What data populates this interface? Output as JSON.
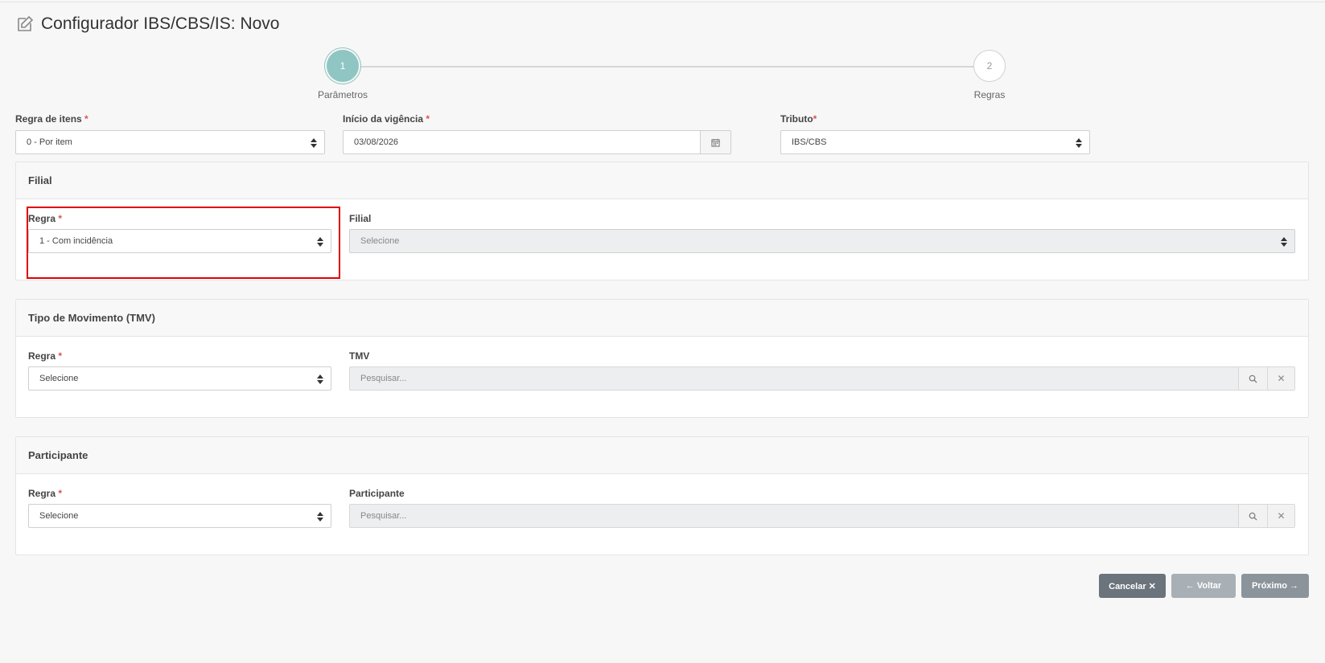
{
  "header": {
    "title": "Configurador IBS/CBS/IS: Novo",
    "icon": "edit-icon"
  },
  "stepper": {
    "steps": [
      {
        "number": "1",
        "label": "Parâmetros"
      },
      {
        "number": "2",
        "label": "Regras"
      }
    ],
    "active_step": 1
  },
  "params": {
    "regra_itens": {
      "label": "Regra de itens",
      "required": "*",
      "value": "0 - Por item"
    },
    "inicio_vigencia": {
      "label": "Início da vigência",
      "required": "*",
      "value": "03/08/2026"
    },
    "tributo": {
      "label": "Tributo",
      "required": "*",
      "value": "IBS/CBS"
    }
  },
  "filial_panel": {
    "title": "Filial",
    "regra": {
      "label": "Regra",
      "required": "*",
      "value": "1 - Com incidência"
    },
    "filial": {
      "label": "Filial",
      "placeholder": "Selecione"
    }
  },
  "tmv_panel": {
    "title": "Tipo de Movimento (TMV)",
    "regra": {
      "label": "Regra",
      "required": "*",
      "value": "Selecione"
    },
    "tmv": {
      "label": "TMV",
      "placeholder": "Pesquisar..."
    }
  },
  "participante_panel": {
    "title": "Participante",
    "regra": {
      "label": "Regra",
      "required": "*",
      "value": "Selecione"
    },
    "participante": {
      "label": "Participante",
      "placeholder": "Pesquisar..."
    }
  },
  "actions": {
    "cancel": "Cancelar ✕",
    "back": "← Voltar",
    "next": "Próximo →"
  },
  "colors": {
    "accent": "#8fc5c2",
    "required": "#d9534f",
    "highlight": "#e00000"
  }
}
